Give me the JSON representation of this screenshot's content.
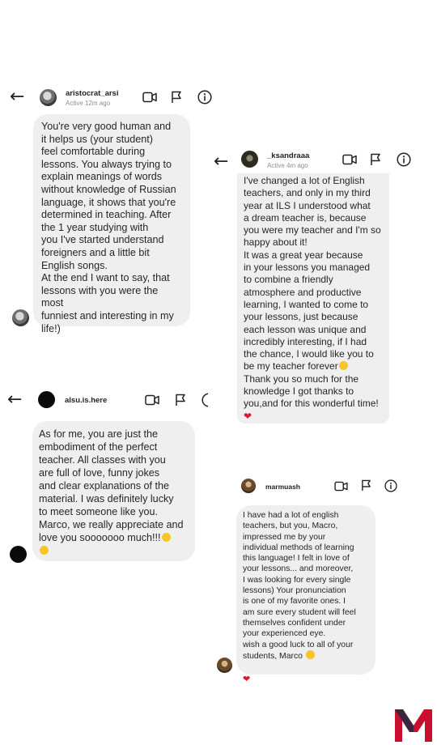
{
  "chat1": {
    "username": "aristocrat_arsi",
    "status": "Active 12m ago",
    "message": "You're very good human and\nit helps us (your student)\nfeel comfortable during\nlessons. You always trying to\nexplain meanings of words\nwithout knowledge of Russian\nlanguage, it shows that you're\ndetermined in teaching. After\nthe 1 year studying with\nyou I've started understand\nforeigners and a little bit\nEnglish songs.\nAt the end I want to say, that\nlessons with you were the most\nfunniest and interesting in my\nlife!)"
  },
  "chat2": {
    "username": "_ksandraaa",
    "status": "Active 4m ago",
    "message": "I've changed a lot of English\nteachers, and only in my third\nyear at ILS  I understood what\na dream teacher is, because\nyou were my teacher and I'm so\nhappy about it!\nIt was a great year because\nin your lessons you managed\nto combine a friendly\natmosphere and productive\nlearning, I wanted to come to\nyour lessons, just because\neach lesson was unique and\nincredibly interesting, if I had\nthe chance, I would like you to\nbe my teacher forever",
    "message_end": "Thank you so much for the\nknowledge I got thanks to\nyou,and for this wonderful time!",
    "heart": "❤"
  },
  "chat3": {
    "username": "alsu.is.here",
    "message": "As for me, you are just the\nembodiment of the perfect\nteacher. All classes with you\nare full of love, funny jokes\nand clear explanations of the\nmaterial. I was definitely lucky\nto meet someone like you.\nMarco, we really appreciate and\nlove you sooooooo much!!!"
  },
  "chat4": {
    "username": "marmuash",
    "message": "I have had a lot of english\nteachers, but you, Macro,\nimpressed me by your\nindividual methods of learning\nthis language! I felt in love of\nyour lessons... and moreover,\nI was looking for every single\nlessons) Your pronunciation\nis one of my favorite ones. I\nam sure every student will feel\nthemselves confident under\nyour experienced eye.\nwish a good luck to all of your\nstudents, Marco",
    "heart": "❤"
  },
  "icons": {
    "back": "arrow-left-icon",
    "video": "video-camera-icon",
    "flag": "flag-icon",
    "info": "info-icon"
  },
  "colors": {
    "bubble": "#efefef",
    "heart": "#e0162b",
    "logo_red": "#c8102e",
    "logo_navy": "#1f2a44"
  }
}
